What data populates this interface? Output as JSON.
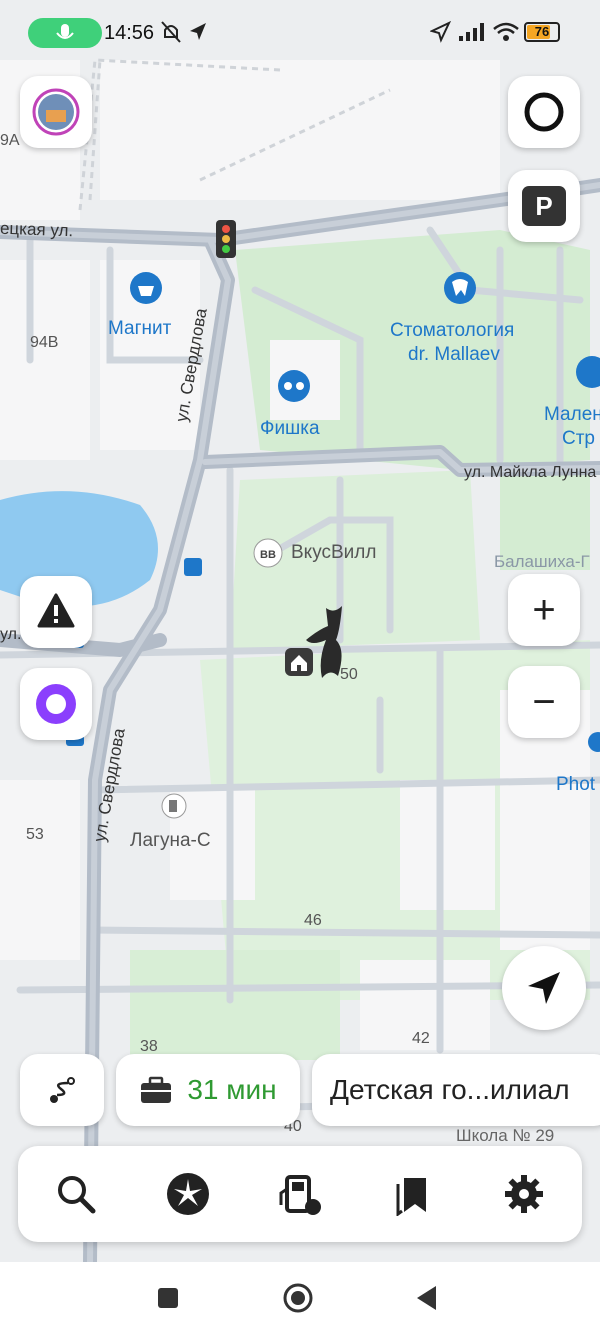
{
  "status_bar": {
    "time": "14:56",
    "battery": "76",
    "battery_level": 0.76
  },
  "map": {
    "streets": [
      "ецкая ул.",
      "ул. Свердлова",
      "ул. Майкла Лунна",
      "ул.",
      "ул. Свердлова"
    ],
    "pois": [
      {
        "name": "Магнит",
        "icon": "shopping-basket-icon"
      },
      {
        "name": "Стоматология",
        "icon": "tooth-icon"
      },
      {
        "name": "dr. Mallaev",
        "icon": ""
      },
      {
        "name": "Фишка",
        "icon": "glasses-icon"
      },
      {
        "name": "Мален",
        "icon": "pin-icon"
      },
      {
        "name": "Стр",
        "icon": ""
      },
      {
        "name": "ВкусВилл",
        "icon": "vkusvill-icon"
      },
      {
        "name": "Балашиха-Г",
        "icon": ""
      },
      {
        "name": "Лагуна-С",
        "icon": "fuel-icon"
      },
      {
        "name": "Phot",
        "icon": ""
      },
      {
        "name": "Школа № 29",
        "icon": ""
      }
    ],
    "house_numbers": [
      "9А",
      "94В",
      "50",
      "53",
      "46",
      "42",
      "38",
      "40"
    ],
    "colors": {
      "road": "#aeb6c2",
      "park": "#d4ecd2",
      "water": "#8fc9f0",
      "poi": "#1e77c9"
    }
  },
  "user_marker": {
    "icon": "home-icon",
    "cursor": "bat-cursor-icon"
  },
  "buttons": {
    "profile": "avatar-icon",
    "alice_ring": "alice-ring-icon",
    "parking": "P",
    "incident": "warning-icon",
    "alice": "alice-icon",
    "zoom_in": "+",
    "zoom_out": "−",
    "locate": "navigation-arrow-icon"
  },
  "route_bar": {
    "route_icon": "route-icon",
    "work_icon": "briefcase-icon",
    "eta": "31 мин",
    "destination": "Детская го...илиал"
  },
  "toolbar": {
    "items": [
      "search-icon",
      "discovery-icon",
      "fuel-station-icon",
      "bookmarks-icon",
      "settings-icon"
    ]
  },
  "nav_bar": {
    "items": [
      "recents-icon",
      "home-icon",
      "back-icon"
    ]
  }
}
